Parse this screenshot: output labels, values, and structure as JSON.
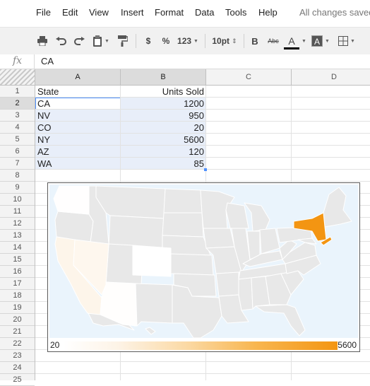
{
  "menu": {
    "items": [
      "File",
      "Edit",
      "View",
      "Insert",
      "Format",
      "Data",
      "Tools",
      "Help"
    ],
    "save_status": "All changes saved"
  },
  "toolbar": {
    "currency": "$",
    "percent": "%",
    "number_format": "123",
    "font_size": "10pt",
    "bold": "B",
    "strikethrough": "Abc",
    "text_color": "A",
    "highlight": "A",
    "icons": [
      "print-icon",
      "undo-icon",
      "redo-icon",
      "paste-icon",
      "paint-format-icon",
      "borders-icon"
    ],
    "text_color_swatch": "#000000"
  },
  "formula": {
    "fx": "fx",
    "value": "CA"
  },
  "columns": [
    "A",
    "B",
    "C",
    "D"
  ],
  "rows": [
    "1",
    "2",
    "3",
    "4",
    "5",
    "6",
    "7",
    "8",
    "9",
    "10",
    "11",
    "12",
    "13",
    "14",
    "15",
    "16",
    "17",
    "18",
    "19",
    "20",
    "21",
    "22",
    "23",
    "24",
    "25"
  ],
  "sheet": {
    "header": [
      "State",
      "Units Sold"
    ],
    "data": [
      [
        "CA",
        "1200"
      ],
      [
        "NV",
        "950"
      ],
      [
        "CO",
        "20"
      ],
      [
        "NY",
        "5600"
      ],
      [
        "AZ",
        "120"
      ],
      [
        "WA",
        "85"
      ]
    ]
  },
  "chart": {
    "legend_min": "20",
    "legend_max": "5600",
    "colors": {
      "background": "#eaf4fc",
      "no_data": "#e8e8e8",
      "min": "#ffffff",
      "max": "#f39512"
    }
  },
  "chart_data": {
    "type": "heatmap",
    "categories": [
      "CA",
      "NV",
      "CO",
      "NY",
      "AZ",
      "WA"
    ],
    "values": [
      1200,
      950,
      20,
      5600,
      120,
      85
    ],
    "color_range": [
      20,
      5600
    ]
  }
}
